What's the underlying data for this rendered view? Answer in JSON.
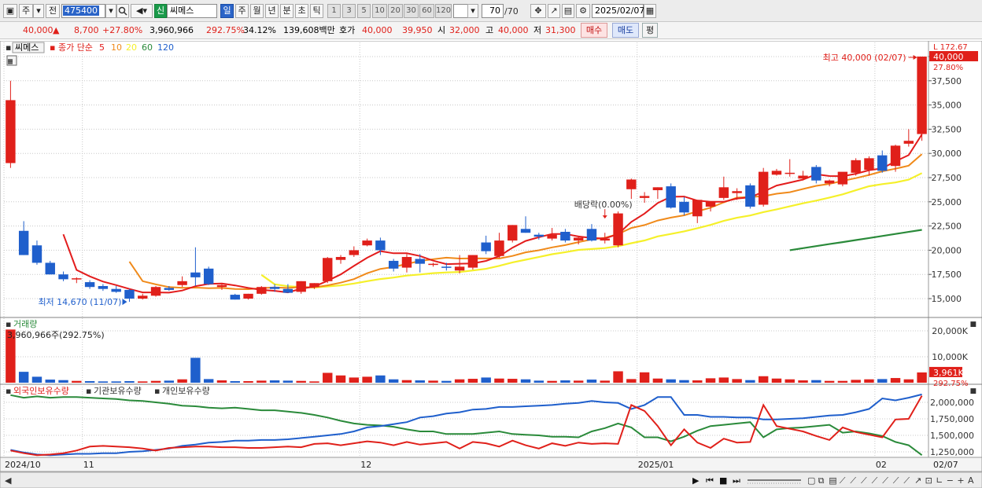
{
  "toolbar": {
    "market": "주",
    "prev_label": "전",
    "code": "475400",
    "type_badge": "신",
    "name": "씨메스",
    "periods": [
      "일",
      "주",
      "월",
      "년",
      "분",
      "초",
      "틱"
    ],
    "minutes": [
      "1",
      "3",
      "5",
      "10",
      "20",
      "30",
      "60",
      "120"
    ],
    "count_value": "70",
    "count_total": "/70",
    "date": "2025/02/07"
  },
  "quote": {
    "price": "40,000",
    "arrow": "▲",
    "change": "8,700",
    "change_pct": "+27.80%",
    "volume": "3,960,966",
    "volume_ratio": "292.75%",
    "turnover": "34.12%",
    "value": "139,608백만",
    "bid_label": "호가",
    "ask": "40,000",
    "bid": "39,950",
    "open_label": "시",
    "open": "32,000",
    "high_label": "고",
    "high": "40,000",
    "low_label": "저",
    "low": "31,300",
    "buy_label": "매수",
    "sell_label": "매도",
    "avg_label": "평"
  },
  "colors": {
    "up": "#e0201a",
    "down": "#1f5fcc",
    "ma5": "#e31c1c",
    "ma10": "#f08a1a",
    "ma20": "#f5f02a",
    "ma60": "#2a8a3a"
  },
  "legend": {
    "name": "씨메스",
    "price_label": "종가 단순",
    "ma": [
      "5",
      "10",
      "20",
      "60",
      "120"
    ]
  },
  "annotations": {
    "high": "최고 40,000 (02/07)",
    "low": "최저 14,670 (11/07)",
    "dividend": "배당락(0.00%)"
  },
  "price_axis": {
    "labels": [
      "40,000",
      "37,500",
      "35,000",
      "32,500",
      "30,000",
      "27,500",
      "25,000",
      "22,500",
      "20,000",
      "17,500",
      "15,000"
    ],
    "current": "40,000",
    "current_pct": "27.80%",
    "top_partial": "172.67"
  },
  "volume_panel": {
    "title": "거래량",
    "value_text": "3,960,966주(292.75%)",
    "axis": [
      "20,000K",
      "10,000K"
    ],
    "current": "3,961K",
    "current_pct": "292.75%"
  },
  "holdings_panel": {
    "legend": [
      "외국인보유수량",
      "기관보유수량",
      "개인보유수량"
    ],
    "axis": [
      "2,000,000",
      "1,750,000",
      "1,500,000",
      "1,250,000"
    ]
  },
  "date_axis": {
    "labels": [
      "2024/10",
      "11",
      "12",
      "2025/01",
      "02"
    ],
    "last": "02/07"
  },
  "chart_data": {
    "type": "candlestick",
    "ohlc": [
      [
        29000,
        37500,
        28500,
        35500
      ],
      [
        22000,
        23000,
        19500,
        19500
      ],
      [
        20500,
        21000,
        18500,
        18700
      ],
      [
        18700,
        18900,
        17500,
        17500
      ],
      [
        17500,
        17800,
        16800,
        17000
      ],
      [
        17000,
        17200,
        16600,
        17100
      ],
      [
        16700,
        16900,
        16000,
        16200
      ],
      [
        16300,
        16500,
        15800,
        16000
      ],
      [
        16000,
        16300,
        15600,
        15700
      ],
      [
        15900,
        16000,
        14670,
        15000
      ],
      [
        15000,
        15500,
        14900,
        15300
      ],
      [
        15300,
        16300,
        15200,
        16200
      ],
      [
        16100,
        16300,
        15800,
        15900
      ],
      [
        16400,
        17300,
        16200,
        16800
      ],
      [
        17700,
        20300,
        16300,
        17200
      ],
      [
        18100,
        18300,
        16400,
        16500
      ],
      [
        16200,
        16600,
        15900,
        16400
      ],
      [
        15400,
        15500,
        14900,
        14900
      ],
      [
        15000,
        15500,
        14900,
        15500
      ],
      [
        15500,
        16300,
        15400,
        16200
      ],
      [
        16200,
        16500,
        15700,
        16000
      ],
      [
        16000,
        16500,
        15600,
        15600
      ],
      [
        15700,
        16800,
        15500,
        16800
      ],
      [
        16200,
        16600,
        16000,
        16600
      ],
      [
        16800,
        19300,
        16600,
        19200
      ],
      [
        19000,
        19500,
        18600,
        19300
      ],
      [
        19500,
        20400,
        19300,
        20000
      ],
      [
        20500,
        21200,
        20400,
        21000
      ],
      [
        21000,
        21300,
        19500,
        20000
      ],
      [
        18900,
        19100,
        17800,
        18100
      ],
      [
        18200,
        19600,
        17700,
        19300
      ],
      [
        19100,
        19600,
        17700,
        18600
      ],
      [
        18500,
        18700,
        18300,
        18600
      ],
      [
        18300,
        18700,
        17900,
        18200
      ],
      [
        17900,
        19500,
        17600,
        18300
      ],
      [
        18200,
        19500,
        18000,
        19500
      ],
      [
        20800,
        21500,
        19600,
        19900
      ],
      [
        19400,
        21800,
        19200,
        21000
      ],
      [
        21000,
        22600,
        20800,
        22600
      ],
      [
        22200,
        23500,
        21800,
        21800
      ],
      [
        21600,
        21800,
        21100,
        21400
      ],
      [
        21200,
        22300,
        21000,
        21600
      ],
      [
        21900,
        22200,
        20800,
        21000
      ],
      [
        21000,
        21500,
        20600,
        21300
      ],
      [
        22200,
        22700,
        20900,
        21000
      ],
      [
        21000,
        21800,
        20700,
        21200
      ],
      [
        20500,
        24000,
        20300,
        23800
      ],
      [
        26300,
        27400,
        25300,
        27300
      ],
      [
        25400,
        26000,
        24900,
        25600
      ],
      [
        26200,
        26500,
        25300,
        26500
      ],
      [
        26600,
        26900,
        24300,
        24400
      ],
      [
        25000,
        25500,
        23600,
        23900
      ],
      [
        23500,
        25000,
        22800,
        25200
      ],
      [
        24500,
        25000,
        24000,
        25000
      ],
      [
        25400,
        27600,
        25200,
        26500
      ],
      [
        25900,
        26400,
        25200,
        26100
      ],
      [
        26700,
        26900,
        24300,
        24500
      ],
      [
        24700,
        28500,
        24500,
        28100
      ],
      [
        27800,
        28400,
        27700,
        28200
      ],
      [
        27900,
        29400,
        27600,
        28000
      ],
      [
        27400,
        28200,
        27200,
        27700
      ],
      [
        28600,
        28800,
        26900,
        27200
      ],
      [
        26900,
        27300,
        26600,
        27200
      ],
      [
        26800,
        27800,
        26600,
        28100
      ],
      [
        28000,
        29500,
        27700,
        29300
      ],
      [
        28300,
        29700,
        27700,
        29500
      ],
      [
        29800,
        30300,
        28000,
        28200
      ],
      [
        28700,
        30900,
        28100,
        30800
      ],
      [
        31000,
        32500,
        30700,
        31300
      ],
      [
        32000,
        40000,
        31300,
        40000
      ]
    ],
    "volume_k": [
      20500,
      4200,
      2300,
      1200,
      1000,
      700,
      600,
      500,
      500,
      600,
      500,
      700,
      800,
      1300,
      9600,
      1400,
      900,
      600,
      600,
      800,
      900,
      800,
      700,
      500,
      3800,
      2800,
      2000,
      2300,
      2800,
      1300,
      1000,
      900,
      800,
      700,
      1300,
      1500,
      2000,
      1600,
      1500,
      1300,
      800,
      700,
      900,
      800,
      1200,
      800,
      4400,
      1400,
      4000,
      1600,
      1300,
      1000,
      900,
      1700,
      2000,
      1400,
      1000,
      2500,
      1600,
      1300,
      900,
      1000,
      700,
      700,
      1100,
      1300,
      1400,
      1800,
      1300,
      3961
    ],
    "foreign_holdings": [
      1270000,
      1230000,
      1200000,
      1210000,
      1230000,
      1270000,
      1330000,
      1340000,
      1330000,
      1320000,
      1300000,
      1270000,
      1310000,
      1320000,
      1330000,
      1330000,
      1320000,
      1320000,
      1310000,
      1310000,
      1320000,
      1330000,
      1320000,
      1370000,
      1380000,
      1350000,
      1380000,
      1410000,
      1390000,
      1350000,
      1400000,
      1360000,
      1380000,
      1400000,
      1300000,
      1400000,
      1380000,
      1330000,
      1420000,
      1350000,
      1300000,
      1380000,
      1340000,
      1390000,
      1370000,
      1380000,
      1370000,
      1960000,
      1870000,
      1640000,
      1350000,
      1590000,
      1390000,
      1310000,
      1450000,
      1390000,
      1400000,
      1960000,
      1640000,
      1600000,
      1560000,
      1490000,
      1430000,
      1620000,
      1550000,
      1510000,
      1470000,
      1740000,
      1750000,
      2100000
    ],
    "institution_holdings": [
      1280000,
      1240000,
      1210000,
      1200000,
      1210000,
      1220000,
      1220000,
      1230000,
      1230000,
      1250000,
      1260000,
      1280000,
      1300000,
      1340000,
      1360000,
      1390000,
      1400000,
      1420000,
      1420000,
      1430000,
      1430000,
      1440000,
      1460000,
      1480000,
      1500000,
      1520000,
      1560000,
      1620000,
      1640000,
      1670000,
      1700000,
      1770000,
      1790000,
      1830000,
      1850000,
      1890000,
      1900000,
      1930000,
      1930000,
      1940000,
      1950000,
      1960000,
      1980000,
      1990000,
      2020000,
      2000000,
      1990000,
      1900000,
      1960000,
      2080000,
      2080000,
      1810000,
      1810000,
      1780000,
      1780000,
      1770000,
      1770000,
      1740000,
      1740000,
      1750000,
      1760000,
      1780000,
      1800000,
      1810000,
      1850000,
      1900000,
      2060000,
      2030000,
      2070000,
      2120000
    ],
    "individual_holdings": [
      2110000,
      2070000,
      2090000,
      2070000,
      2080000,
      2080000,
      2070000,
      2060000,
      2050000,
      2030000,
      2020000,
      2000000,
      1980000,
      1950000,
      1940000,
      1920000,
      1910000,
      1920000,
      1900000,
      1880000,
      1880000,
      1860000,
      1840000,
      1810000,
      1770000,
      1720000,
      1680000,
      1660000,
      1650000,
      1630000,
      1590000,
      1560000,
      1560000,
      1520000,
      1520000,
      1520000,
      1540000,
      1560000,
      1520000,
      1510000,
      1500000,
      1480000,
      1480000,
      1470000,
      1560000,
      1610000,
      1680000,
      1620000,
      1470000,
      1470000,
      1410000,
      1480000,
      1570000,
      1640000,
      1660000,
      1680000,
      1700000,
      1470000,
      1590000,
      1610000,
      1620000,
      1640000,
      1660000,
      1540000,
      1560000,
      1530000,
      1490000,
      1400000,
      1350000,
      1200000
    ]
  }
}
